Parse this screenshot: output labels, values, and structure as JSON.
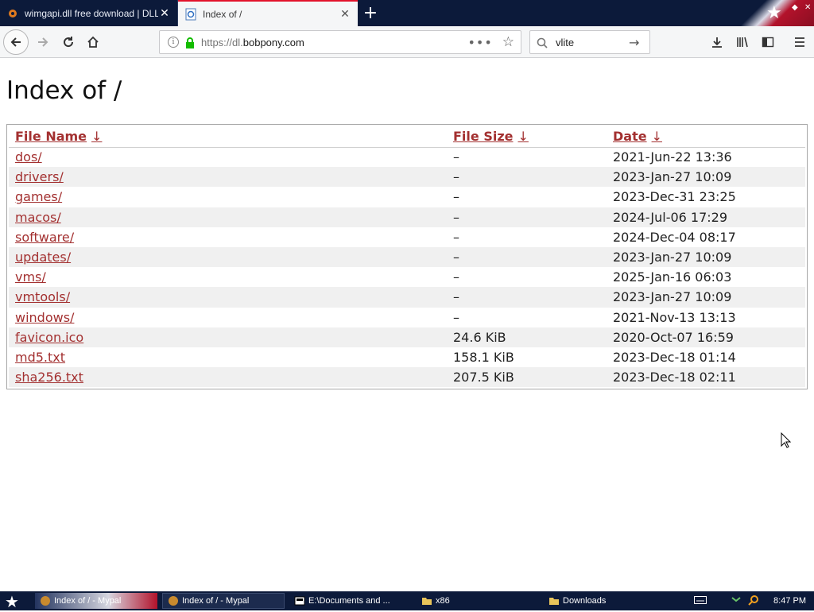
{
  "browser": {
    "tabs": [
      {
        "title": "wimgapi.dll free download | DLL-fi",
        "active": false
      },
      {
        "title": "Index of /",
        "active": true
      }
    ],
    "url_prefix": "https://dl.",
    "url_host": "bobpony.com",
    "search_value": "vlite"
  },
  "page": {
    "title": "Index of /",
    "columns": {
      "name": "File Name",
      "size": "File Size",
      "date": "Date",
      "sort_arrow": "↓"
    },
    "rows": [
      {
        "name": "dos/",
        "size": "–",
        "date": "2021-Jun-22 13:36"
      },
      {
        "name": "drivers/",
        "size": "–",
        "date": "2023-Jan-27 10:09"
      },
      {
        "name": "games/",
        "size": "–",
        "date": "2023-Dec-31 23:25"
      },
      {
        "name": "macos/",
        "size": "–",
        "date": "2024-Jul-06 17:29"
      },
      {
        "name": "software/",
        "size": "–",
        "date": "2024-Dec-04 08:17"
      },
      {
        "name": "updates/",
        "size": "–",
        "date": "2023-Jan-27 10:09"
      },
      {
        "name": "vms/",
        "size": "–",
        "date": "2025-Jan-16 06:03"
      },
      {
        "name": "vmtools/",
        "size": "–",
        "date": "2023-Jan-27 10:09"
      },
      {
        "name": "windows/",
        "size": "–",
        "date": "2021-Nov-13 13:13"
      },
      {
        "name": "favicon.ico",
        "size": "24.6 KiB",
        "date": "2020-Oct-07 16:59"
      },
      {
        "name": "md5.txt",
        "size": "158.1 KiB",
        "date": "2023-Dec-18 01:14"
      },
      {
        "name": "sha256.txt",
        "size": "207.5 KiB",
        "date": "2023-Dec-18 02:11"
      }
    ],
    "link_color": "#a33030"
  },
  "taskbar": {
    "items": [
      {
        "label": "Index of / - Mypal",
        "active": false
      },
      {
        "label": "Index of / - Mypal",
        "active": true
      },
      {
        "label": "E:\\Documents and ...",
        "active": false
      },
      {
        "label": "x86",
        "active": false
      },
      {
        "label": "Downloads",
        "active": false
      }
    ],
    "clock": "8:47 PM"
  },
  "colors": {
    "accent": "#e3132b",
    "taskbar_bg": "#0c1a3a"
  }
}
